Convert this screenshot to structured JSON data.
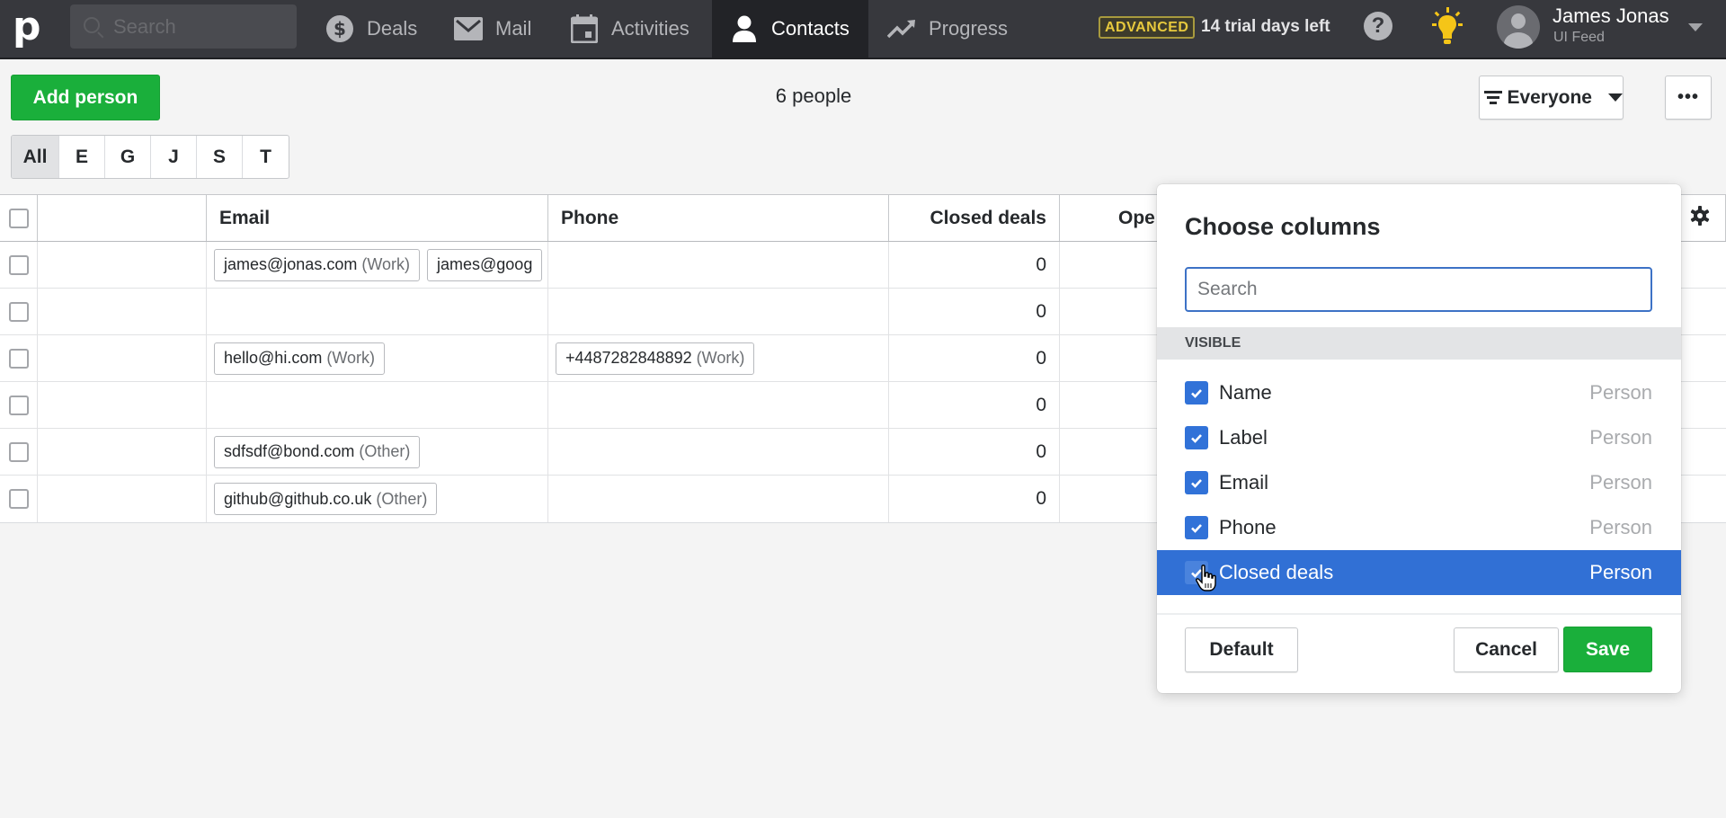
{
  "app": {
    "logo": "p",
    "search_placeholder": "Search"
  },
  "nav": {
    "items": [
      {
        "label": "Deals",
        "icon": "dollar-circle-icon",
        "active": false
      },
      {
        "label": "Mail",
        "icon": "envelope-icon",
        "active": false
      },
      {
        "label": "Activities",
        "icon": "calendar-icon",
        "active": false
      },
      {
        "label": "Contacts",
        "icon": "person-icon",
        "active": true
      },
      {
        "label": "Progress",
        "icon": "trend-up-icon",
        "active": false
      }
    ],
    "plan_badge": "ADVANCED",
    "trial_text": "14 trial days left",
    "help_glyph": "?",
    "user": {
      "name": "James Jonas",
      "company": "UI Feed"
    }
  },
  "toolbar": {
    "add_person_label": "Add person",
    "people_count": "6 people",
    "filter_label": "Everyone",
    "more_label": "•••",
    "letters": [
      {
        "label": "All",
        "active": true
      },
      {
        "label": "E",
        "active": false
      },
      {
        "label": "G",
        "active": false
      },
      {
        "label": "J",
        "active": false
      },
      {
        "label": "S",
        "active": false
      },
      {
        "label": "T",
        "active": false
      }
    ]
  },
  "table": {
    "columns": [
      "",
      "Email",
      "Phone",
      "Closed deals",
      "Ope"
    ],
    "rows": [
      {
        "emails": [
          {
            "value": "james@jonas.com",
            "type": "(Work)"
          },
          {
            "value": "james@goog",
            "type": ""
          }
        ],
        "phones": [],
        "closed_deals": "0"
      },
      {
        "emails": [],
        "phones": [],
        "closed_deals": "0"
      },
      {
        "emails": [
          {
            "value": "hello@hi.com",
            "type": "(Work)"
          }
        ],
        "phones": [
          {
            "value": "+4487282848892",
            "type": "(Work)"
          }
        ],
        "closed_deals": "0"
      },
      {
        "emails": [],
        "phones": [],
        "closed_deals": "0"
      },
      {
        "emails": [
          {
            "value": "sdfsdf@bond.com",
            "type": "(Other)"
          }
        ],
        "phones": [],
        "closed_deals": "0"
      },
      {
        "emails": [
          {
            "value": "github@github.co.uk",
            "type": "(Other)"
          }
        ],
        "phones": [],
        "closed_deals": "0"
      }
    ]
  },
  "column_chooser": {
    "title": "Choose columns",
    "search_placeholder": "Search",
    "section_label": "VISIBLE",
    "items": [
      {
        "label": "Name",
        "group": "Person",
        "checked": true,
        "highlighted": false
      },
      {
        "label": "Label",
        "group": "Person",
        "checked": true,
        "highlighted": false
      },
      {
        "label": "Email",
        "group": "Person",
        "checked": true,
        "highlighted": false
      },
      {
        "label": "Phone",
        "group": "Person",
        "checked": true,
        "highlighted": false
      },
      {
        "label": "Closed deals",
        "group": "Person",
        "checked": true,
        "highlighted": true
      }
    ],
    "default_label": "Default",
    "cancel_label": "Cancel",
    "save_label": "Save"
  },
  "colors": {
    "topbar": "#37383d",
    "topbar_active": "#222327",
    "green": "#1aaf3b",
    "blue": "#3170d5",
    "badge_yellow": "#e7c93d"
  }
}
